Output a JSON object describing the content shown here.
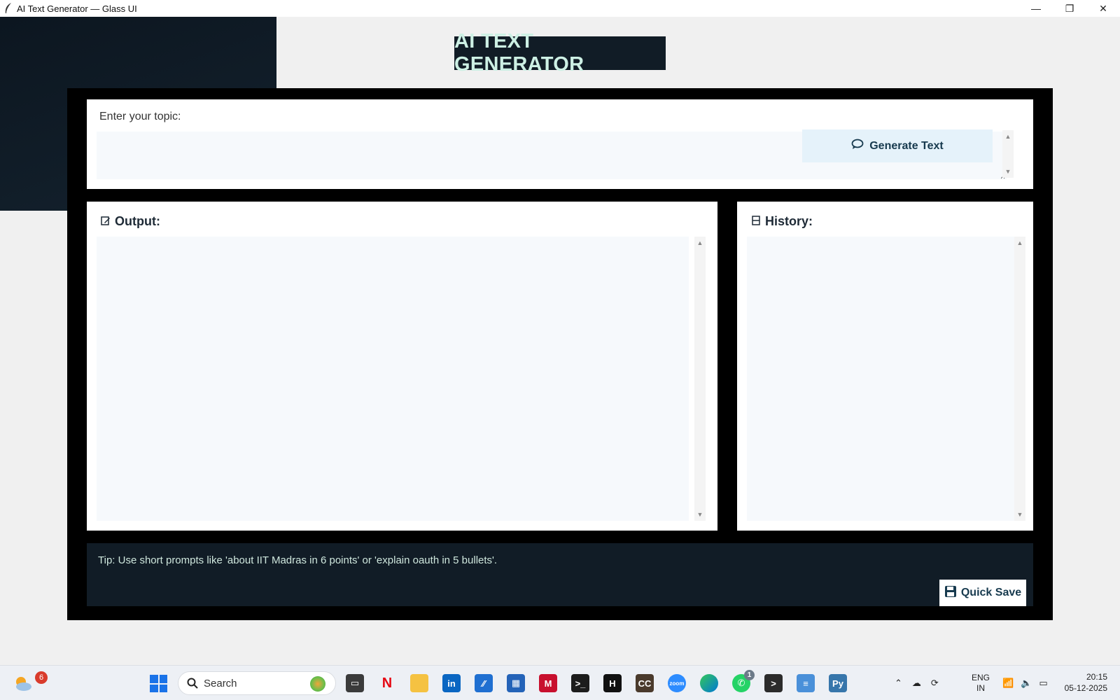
{
  "window": {
    "title": "AI Text Generator — Glass UI",
    "controls": [
      "minimize",
      "restore",
      "close"
    ]
  },
  "app": {
    "heading": "AI TEXT GENERATOR",
    "topic": {
      "label": "Enter your topic:",
      "value": "",
      "generate_label": "Generate Text"
    },
    "output": {
      "label": "Output:",
      "text": ""
    },
    "history": {
      "label": "History:",
      "text": ""
    },
    "tip": "Tip: Use short prompts like 'about IIT Madras in 6 points' or 'explain oauth in 5 bullets'.",
    "quick_save_label": "Quick Save"
  },
  "taskbar": {
    "weather_badge": "6",
    "search_label": "Search",
    "whatsapp_badge": "1",
    "lang_top": "ENG",
    "lang_bottom": "IN",
    "time": "20:15",
    "date": "05-12-2025",
    "apps": [
      "file-explorer-icon",
      "netflix-icon",
      "folder-icon",
      "linkedin-icon",
      "azure-icon",
      "store-icon",
      "mcafee-icon",
      "terminal-icon",
      "hackerrank-icon",
      "capcut-icon",
      "zoom-icon",
      "edge-icon",
      "whatsapp-icon",
      "powershell-icon",
      "notepad-icon",
      "python-icon"
    ]
  },
  "colors": {
    "dark_panel": "#111c26",
    "accent_text": "#cdf0e4",
    "button_bg": "#e5f2fa",
    "frame": "#000000"
  }
}
